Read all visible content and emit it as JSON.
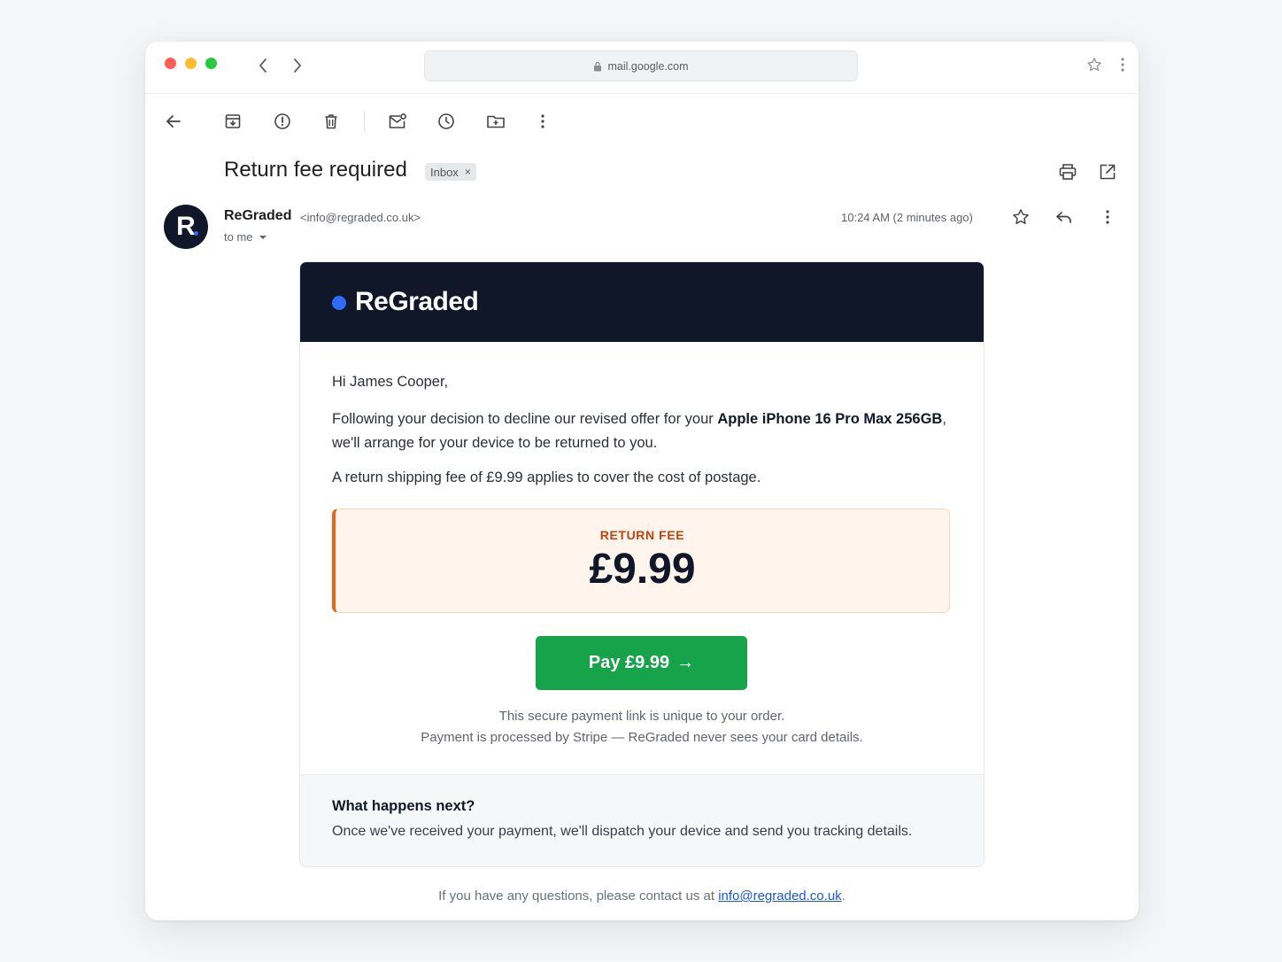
{
  "browser": {
    "url": "mail.google.com"
  },
  "email": {
    "subject": "Return fee required",
    "label": "Inbox",
    "label_remove": "×",
    "sender_name": "ReGraded",
    "sender_email": "<info@regraded.co.uk>",
    "recipient": "to me",
    "timestamp": "10:24 AM (2 minutes ago)",
    "avatar_letter": "R"
  },
  "message": {
    "brand": "ReGraded",
    "greeting": "Hi James Cooper,",
    "para1_before": "Following your decision to decline our revised offer for your ",
    "para1_product": "Apple iPhone 16 Pro Max 256GB",
    "para1_after": ", we'll arrange for your device to be returned to you.",
    "para2": "A return shipping fee of £9.99 applies to cover the cost of postage.",
    "fee_label": "RETURN FEE",
    "fee_amount": "£9.99",
    "pay_button": "Pay £9.99",
    "pay_arrow": "→",
    "secure_line1": "This secure payment link is unique to your order.",
    "secure_line2": "Payment is processed by Stripe — ReGraded never sees your card details.",
    "next_title": "What happens next?",
    "next_text": "Once we've received your payment, we'll dispatch your device and send you tracking details.",
    "footer_before": "If you have any questions, please contact us at ",
    "footer_link": "info@regraded.co.uk",
    "footer_after": "."
  },
  "colors": {
    "brand_dark": "#0f1729",
    "brand_blue": "#2f6bff",
    "pay_green": "#16a34a",
    "fee_orange": "#e8661a",
    "fee_bg": "#fff5ec"
  }
}
